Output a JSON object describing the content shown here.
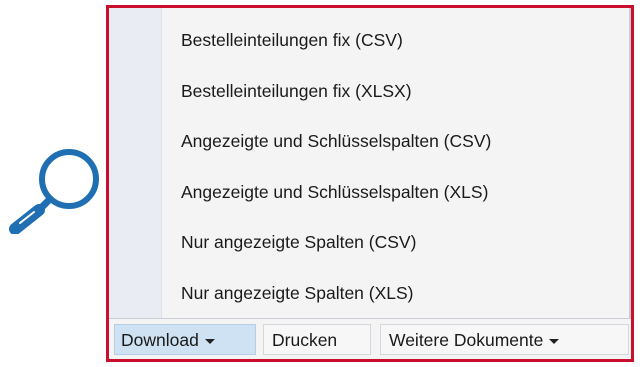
{
  "colors": {
    "highlight_frame": "#c8102e",
    "magnifier": "#1f6fb2",
    "active_button": "#cfe2f3"
  },
  "icons": {
    "magnifier": "magnifier-icon",
    "dropdown": "caret-down-icon"
  },
  "download_menu": {
    "items": [
      {
        "label": "Bestelleinteilungen fix (CSV)"
      },
      {
        "label": "Bestelleinteilungen fix (XLSX)"
      },
      {
        "label": "Angezeigte und Schlüsselspalten (CSV)"
      },
      {
        "label": "Angezeigte und Schlüsselspalten (XLS)"
      },
      {
        "label": "Nur angezeigte Spalten (CSV)"
      },
      {
        "label": "Nur angezeigte Spalten (XLS)"
      }
    ]
  },
  "toolbar": {
    "download_label": "Download",
    "print_label": "Drucken",
    "more_documents_label": "Weitere Dokumente"
  }
}
